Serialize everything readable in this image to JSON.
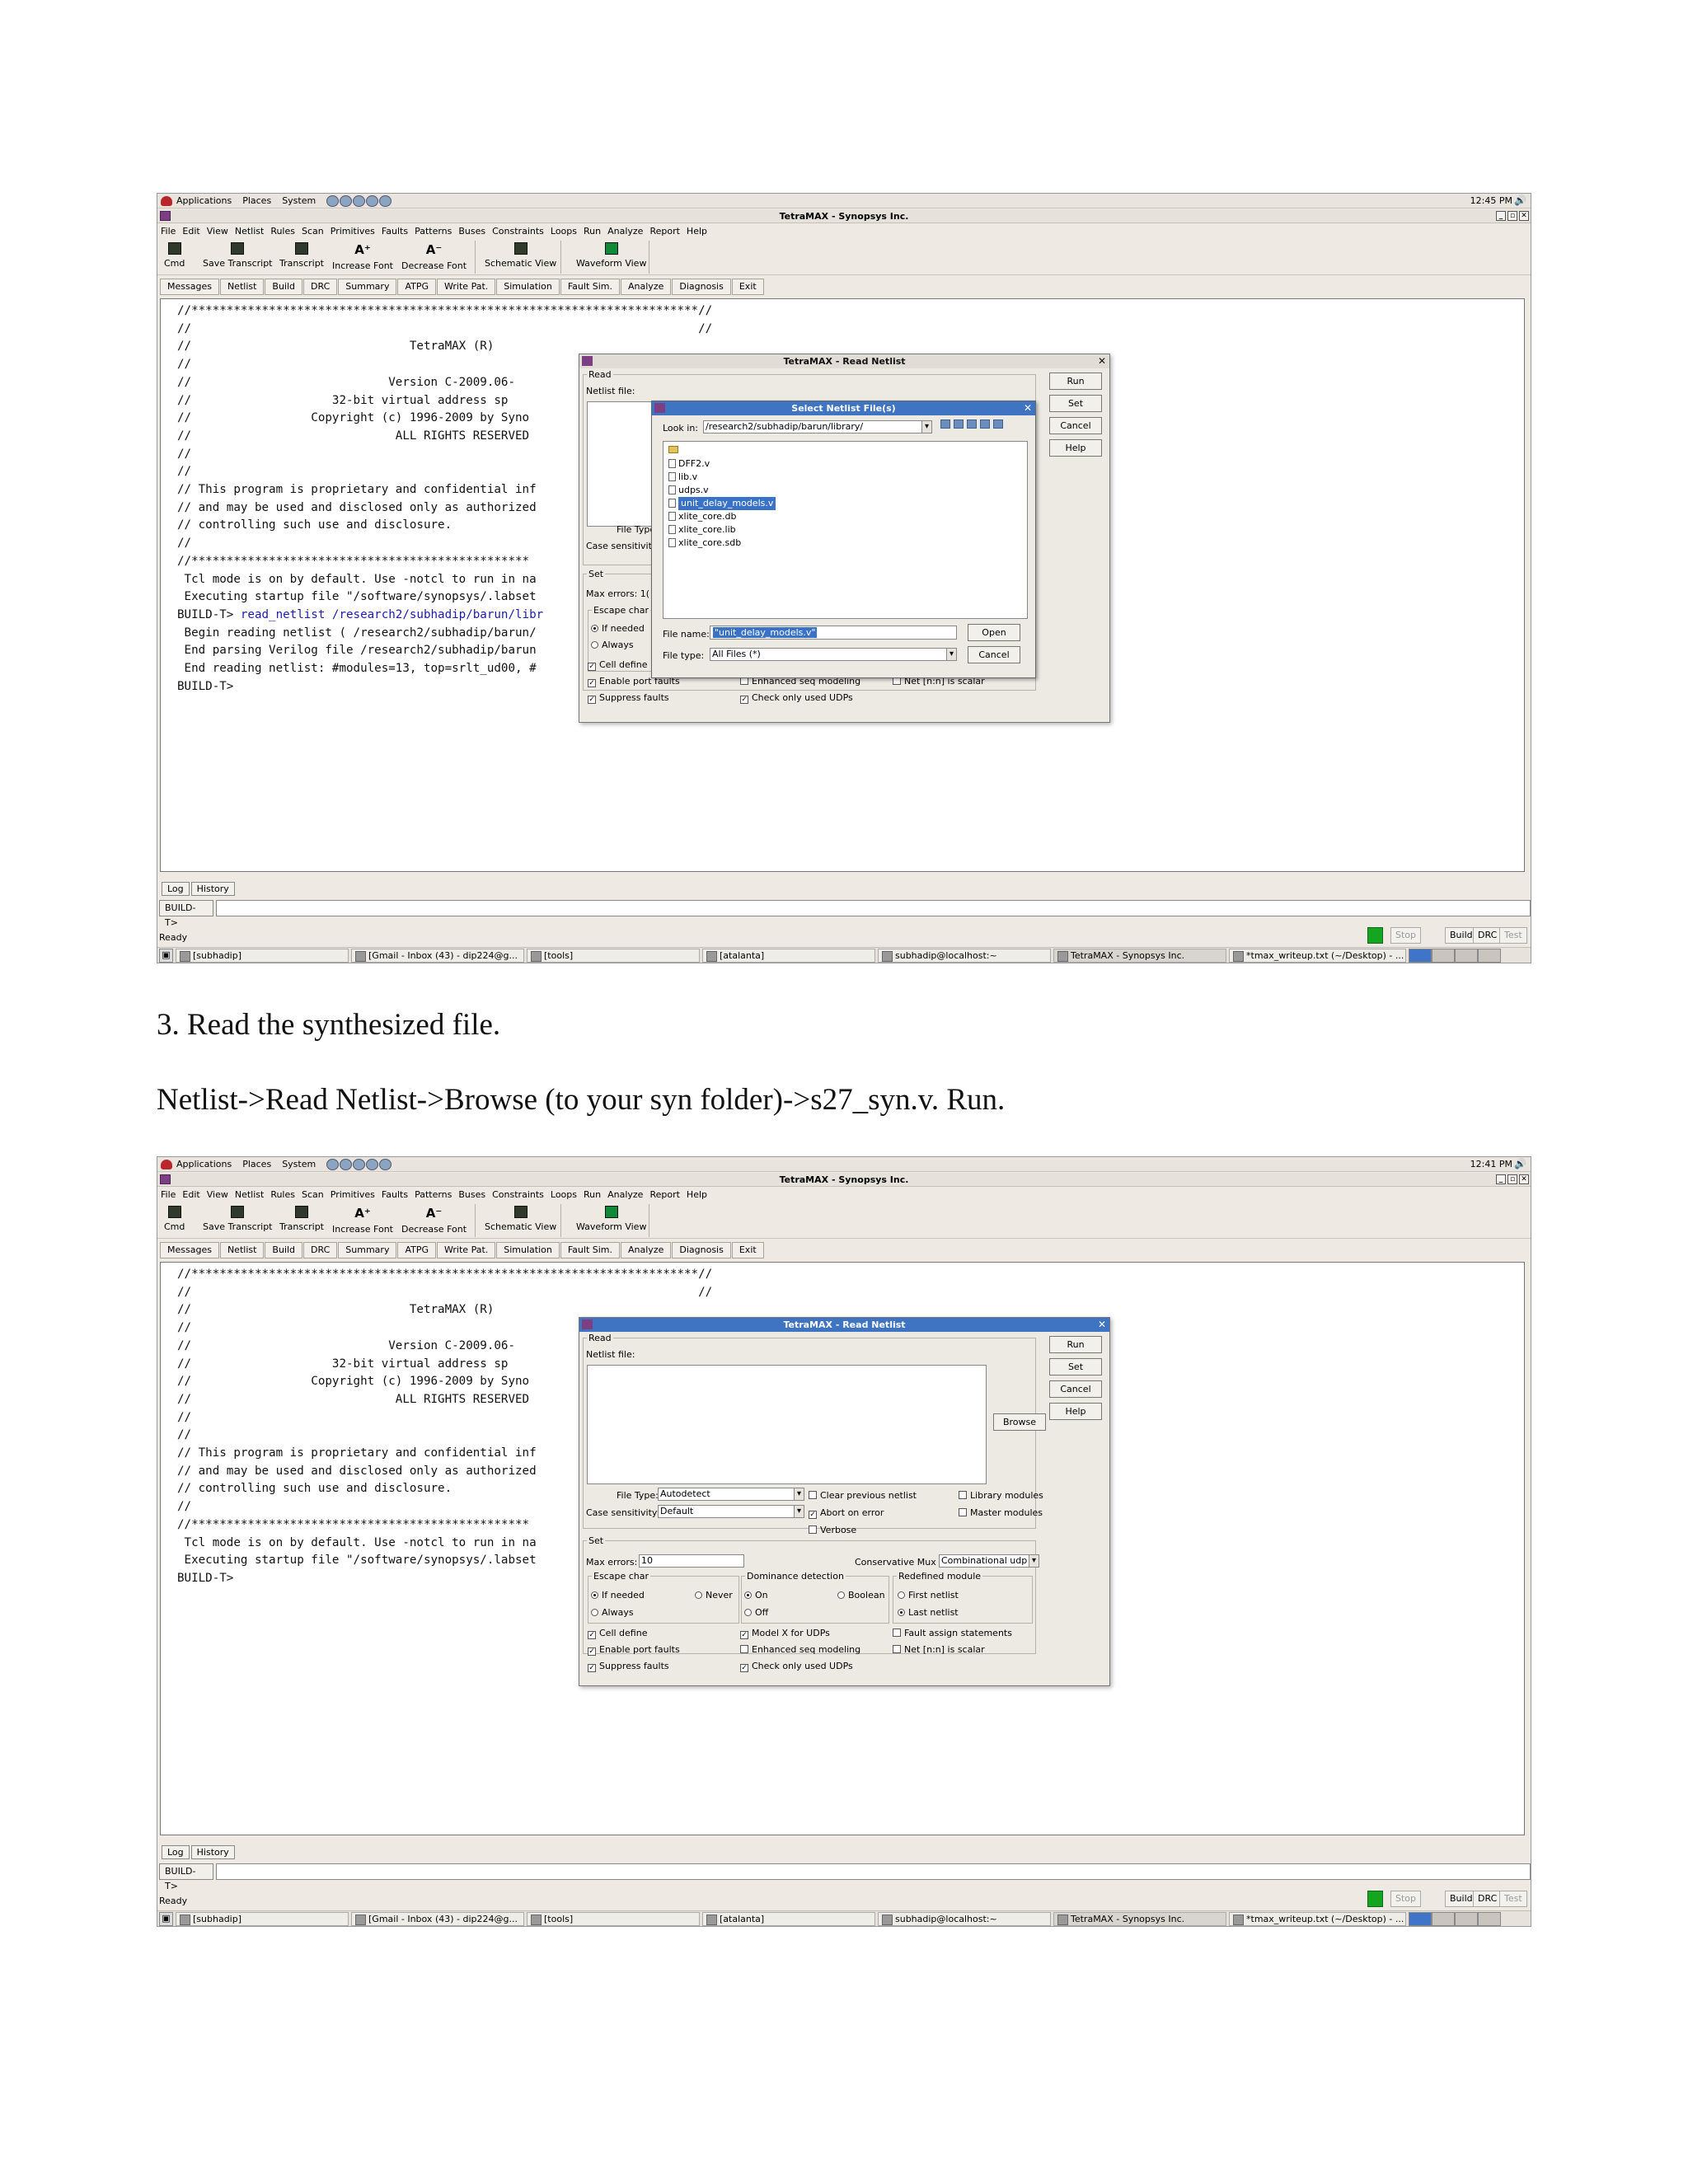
{
  "os_panel": {
    "menus": [
      "Applications",
      "Places",
      "System"
    ],
    "clock_1": "12:45 PM",
    "clock_2": "12:41 PM"
  },
  "window": {
    "title": "TetraMAX - Synopsys Inc.",
    "menu": [
      "File",
      "Edit",
      "View",
      "Netlist",
      "Rules",
      "Scan",
      "Primitives",
      "Faults",
      "Patterns",
      "Buses",
      "Constraints",
      "Loops",
      "Run",
      "Analyze",
      "Report",
      "Help"
    ],
    "toolbar": {
      "cmd": "Cmd",
      "save_transcript": "Save Transcript",
      "transcript": "Transcript",
      "increase_font": "Increase Font",
      "decrease_font": "Decrease Font",
      "schematic_view": "Schematic View",
      "waveform_view": "Waveform View"
    },
    "command_buttons": [
      "Messages",
      "Netlist",
      "Build",
      "DRC",
      "Summary",
      "ATPG",
      "Write Pat.",
      "Simulation",
      "Fault Sim.",
      "Analyze",
      "Diagnosis",
      "Exit"
    ]
  },
  "transcript": {
    "banner": [
      "//************************************************************************//",
      "//                                                                        //",
      "//                               TetraMAX (R)",
      "//",
      "//                            Version C-2009.06-",
      "//                    32-bit virtual address sp",
      "//                 Copyright (c) 1996-2009 by Syno",
      "//                             ALL RIGHTS RESERVED",
      "//",
      "//",
      "// This program is proprietary and confidential inf",
      "// and may be used and disclosed only as authorized",
      "// controlling such use and disclosure.",
      "//",
      "//************************************************"
    ],
    "tcl_line": " Tcl mode is on by default. Use -notcl to run in na",
    "startup_line": " Executing startup file \"/software/synopsys/.labset",
    "prompt": "BUILD-T>",
    "read_cmd": " read_netlist /research2/subhadip/barun/libr",
    "begin_line": " Begin reading netlist ( /research2/subhadip/barun/",
    "end_parse_line": " End parsing Verilog file /research2/subhadip/barun",
    "end_read_line": " End reading netlist: #modules=13, top=srlt_ud00, #"
  },
  "bottom": {
    "log_tab": "Log",
    "history_tab": "History",
    "prompt": "BUILD-T>",
    "status": "Ready",
    "stop": "Stop",
    "build": "Build",
    "drc": "DRC",
    "test": "Test"
  },
  "taskbar": [
    "[subhadip]",
    "[Gmail - Inbox (43) - dip224@g...",
    "[tools]",
    "[atalanta]",
    "subhadip@localhost:~",
    "TetraMAX - Synopsys Inc.",
    "*tmax_writeup.txt (~/Desktop) - ..."
  ],
  "read_netlist": {
    "title": "TetraMAX - Read Netlist",
    "read_group": "Read",
    "netlist_file": "Netlist file:",
    "browse": "Browse",
    "run": "Run",
    "set": "Set",
    "cancel": "Cancel",
    "help": "Help",
    "file_type_label": "File Type:",
    "file_type_value": "Autodetect",
    "case_label": "Case sensitivity:",
    "case_value": "Default",
    "clear_prev": "Clear previous netlist",
    "abort_on_error": "Abort on error",
    "verbose": "Verbose",
    "library_modules": "Library modules",
    "master_modules": "Master modules",
    "set_group": "Set",
    "max_errors_label": "Max errors:",
    "max_errors_value": "10",
    "conservative_label": "Conservative Mux",
    "conservative_value": "Combinational udp",
    "escape_group": "Escape char",
    "if_needed": "If needed",
    "always": "Always",
    "never": "Never",
    "dominance_group": "Dominance detection",
    "on": "On",
    "off": "Off",
    "boolean": "Boolean",
    "redefined_group": "Redefined module",
    "first_netlist": "First netlist",
    "last_netlist": "Last netlist",
    "cell_define": "Cell define",
    "enable_port_faults": "Enable port faults",
    "suppress_faults": "Suppress faults",
    "model_x": "Model X for UDPs",
    "enhanced_seq": "Enhanced seq modeling",
    "check_udps": "Check only used UDPs",
    "fault_assign": "Fault assign statements",
    "net_scalar": "Net [n:n] is scalar",
    "partial_file_type": "File Type",
    "partial_case": "Case sensitivity",
    "partial_max_errors": "Max errors: 1("
  },
  "file_chooser": {
    "title": "Select Netlist File(s)",
    "look_in_label": "Look in:",
    "look_in_value": "/research2/subhadip/barun/library/",
    "files": [
      "DFF2.v",
      "lib.v",
      "udps.v",
      "unit_delay_models.v",
      "xlite_core.db",
      "xlite_core.lib",
      "xlite_core.sdb"
    ],
    "file_name_label": "File name:",
    "file_name_value": "\"unit_delay_models.v\"",
    "file_type_label": "File type:",
    "file_type_value": "All Files (*)",
    "open": "Open",
    "cancel": "Cancel"
  },
  "doc": {
    "step_title": "3. Read the synthesized file.",
    "instruction": "Netlist->Read Netlist->Browse (to your syn folder)->s27_syn.v. Run."
  }
}
